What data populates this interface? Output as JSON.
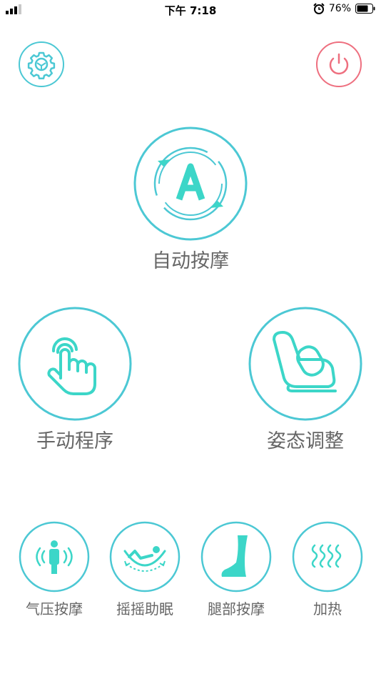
{
  "status_bar": {
    "time": "下午 7:18",
    "battery": "76%",
    "signal_icon": "signal-icon",
    "alarm_icon": "alarm-icon",
    "battery_icon": "battery-icon"
  },
  "header": {
    "settings_icon": "gear-icon",
    "power_icon": "power-icon"
  },
  "main": {
    "auto_label": "自动按摩",
    "manual_label": "手动程序",
    "posture_label": "姿态调整"
  },
  "functions": [
    {
      "label": "气压按摩",
      "icon": "air-pressure-icon"
    },
    {
      "label": "摇摇助眠",
      "icon": "rocking-sleep-icon"
    },
    {
      "label": "腿部按摩",
      "icon": "leg-icon"
    },
    {
      "label": "加热",
      "icon": "heat-icon"
    }
  ],
  "colors": {
    "accent": "#4cc8d4",
    "accent_fill": "#3cd6c8",
    "power": "#ee6f7f",
    "label": "#666666"
  }
}
